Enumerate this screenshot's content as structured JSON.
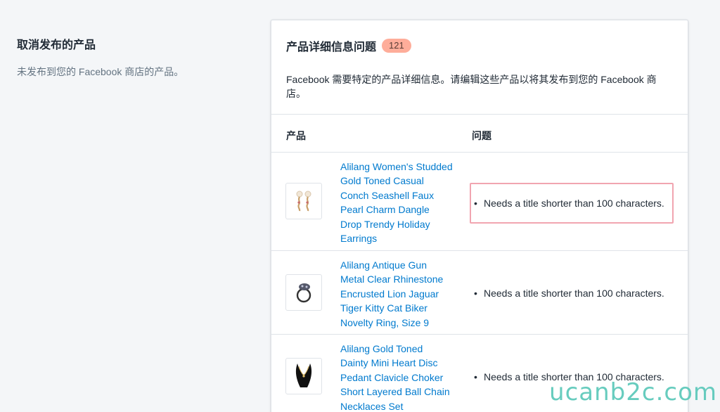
{
  "section": {
    "title": "取消发布的产品",
    "description": "未发布到您的 Facebook 商店的产品。"
  },
  "card": {
    "title": "产品详细信息问题",
    "badge_count": "121",
    "description": "Facebook 需要特定的产品详细信息。请编辑这些产品以将其发布到您的 Facebook 商店。"
  },
  "table": {
    "columns": [
      "产品",
      "问题"
    ],
    "rows": [
      {
        "product": "Alilang Women's Studded Gold Toned Casual Conch Seashell Faux Pearl Charm Dangle Drop Trendy Holiday Earrings",
        "thumbnail_icon": "earrings-thumbnail",
        "issue": "Needs a title shorter than 100 characters."
      },
      {
        "product": "Alilang Antique Gun Metal Clear Rhinestone Encrusted Lion Jaguar Tiger Kitty Cat Biker Novelty Ring, Size 9",
        "thumbnail_icon": "ring-thumbnail",
        "issue": "Needs a title shorter than 100 characters."
      },
      {
        "product": "Alilang Gold Toned Dainty Mini Heart Disc Pedant Clavicle Choker Short Layered Ball Chain Necklaces Set",
        "thumbnail_icon": "necklace-thumbnail",
        "issue": "Needs a title shorter than 100 characters."
      }
    ]
  },
  "watermark": "ucanb2c.com",
  "colors": {
    "link": "#007ace",
    "badge": "#fead9a",
    "highlight_border": "#f1a5b0",
    "watermark": "#57c7b8"
  }
}
